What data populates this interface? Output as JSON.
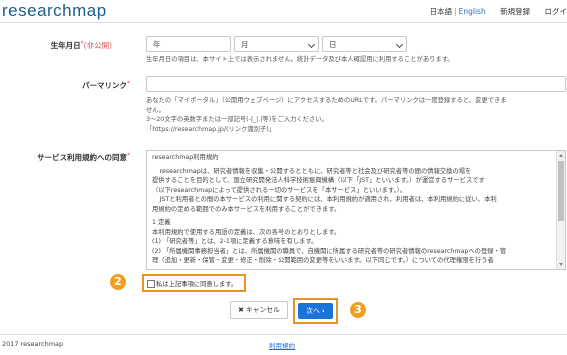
{
  "header": {
    "logo_text": "researchmap",
    "lang_ja": "日本語",
    "lang_sep": "|",
    "lang_en": "English",
    "register": "新規登録",
    "login": "ログイ"
  },
  "birthdate": {
    "label": "生年月日",
    "required_mark": "*",
    "private_note": "(非公開)",
    "year_placeholder": "年",
    "month_placeholder": "月",
    "day_placeholder": "日",
    "help": "生年月日の項目は、本サイト上では表示されません。統計データ及び本人確認用に利用することがあります。"
  },
  "permalink": {
    "label": "パーマリンク",
    "required_mark": "*",
    "help1": "あなたの「マイポータル」（公開用ウェブページ）にアクセスするためのURLです。パーマリンクは一度登録すると、変更できま",
    "help2": "せん。",
    "help3": "3～20文字の英数字または一部記号(-|_|.|等)をご入力ください。",
    "help4": "「https://researchmap.jp/(リンク識別子)」"
  },
  "terms": {
    "label": "サービス利用規約への同意",
    "required_mark": "*",
    "heading": "researchmap利用規約",
    "p1a": "researchmapは、研究者情報を収集・公開するとともに、研究者等と社会及び研究者等の間の情報交換の場を",
    "p1b": "提供することを目的として、国立研究開発法人科学技術振興機構（以下「JST」といいます。）が運営するサービスです",
    "p1c": "（以下researchmapによって提供される一切のサービスを「本サービス」といいます。）。",
    "p2a": "JSTと利用者との間の本サービスの利用に関する契約には、本利用規約が適用され、利用者は、本利用規約に従い、本利",
    "p2b": "用規約の定める範囲でのみ本サービスを利用することができます。",
    "sec1": "1 定義",
    "sec1a": "本利用規約で使用する用語の定義は、次の各号のとおりとします。",
    "sec1b": "(1) 「研究者等」とは、2-1項に定義する意味を有します。",
    "sec1c": "(2) 「所属機関事務担当者」とは、所属機関の職員で、自機関に所属する研究者等の研究者情報のresearchmapへの登録・管",
    "sec1d": "理（追加・更新・保管・変更・修正・削除・公開範囲の変更等をいいます。以下同じです。）についての代理権限を行う者"
  },
  "agree": {
    "label": "私は上記事項に同意します。"
  },
  "annotations": {
    "badge_2": "2",
    "badge_3": "3"
  },
  "actions": {
    "cancel_icon": "✖",
    "cancel_label": "キャンセル",
    "next_label": "次へ",
    "next_icon": "›"
  },
  "footer": {
    "copyright": "2017 researchmap",
    "terms_link": "利用規約"
  },
  "colors": {
    "brand": "#1b5f8c",
    "primary_button": "#1a73d9",
    "highlight": "#e8922a",
    "badge": "#f0a020",
    "required": "#d9534f"
  }
}
